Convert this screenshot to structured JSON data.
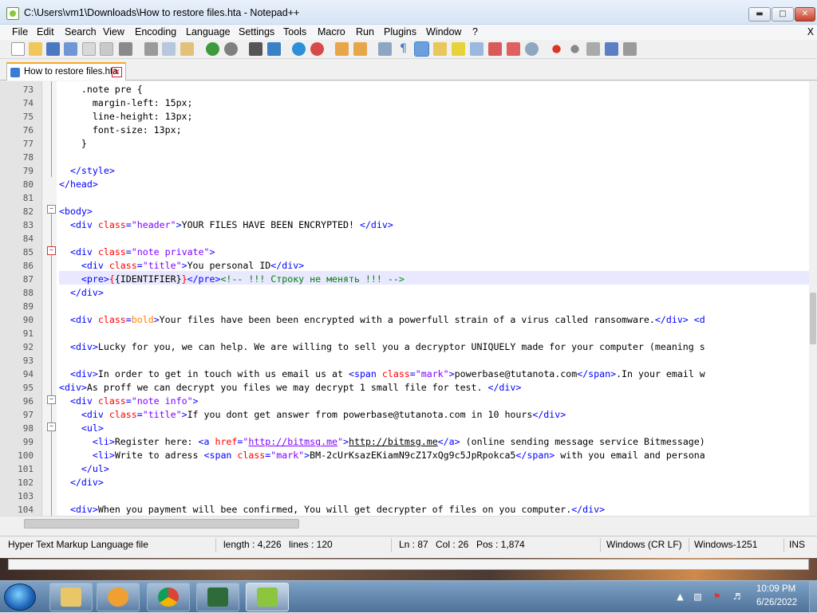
{
  "window": {
    "title": "C:\\Users\\vm1\\Downloads\\How to restore files.hta - Notepad++"
  },
  "menu": [
    "File",
    "Edit",
    "Search",
    "View",
    "Encoding",
    "Language",
    "Settings",
    "Tools",
    "Macro",
    "Run",
    "Plugins",
    "Window",
    "?"
  ],
  "menu_close": "X",
  "tab": {
    "label": "How to restore files.hta"
  },
  "lines": [
    {
      "n": "73",
      "html": "    .note pre {"
    },
    {
      "n": "74",
      "html": "      margin-left: 15px;"
    },
    {
      "n": "75",
      "html": "      line-height: 13px;"
    },
    {
      "n": "76",
      "html": "      font-size: 13px;"
    },
    {
      "n": "77",
      "html": "    }"
    },
    {
      "n": "78",
      "html": ""
    },
    {
      "n": "79",
      "html": "  <span class='t'>&lt;/style&gt;</span>"
    },
    {
      "n": "80",
      "html": "<span class='t'>&lt;/head&gt;</span>"
    },
    {
      "n": "81",
      "html": ""
    },
    {
      "n": "82",
      "html": "<span class='t'>&lt;body&gt;</span>"
    },
    {
      "n": "83",
      "html": "  <span class='t'>&lt;div</span> <span class='a'>class</span><span class='t'>=</span><span class='s'>\"header\"</span><span class='t'>&gt;</span>YOUR FILES HAVE BEEN ENCRYPTED! <span class='t'>&lt;/div&gt;</span>"
    },
    {
      "n": "84",
      "html": ""
    },
    {
      "n": "85",
      "html": "  <span class='t'>&lt;div</span> <span class='a'>class</span><span class='t'>=</span><span class='s'>\"note private\"</span><span class='t'>&gt;</span>"
    },
    {
      "n": "86",
      "html": "    <span class='t'>&lt;div</span> <span class='a'>class</span><span class='t'>=</span><span class='s'>\"title\"</span><span class='t'>&gt;</span>You personal ID<span class='t'>&lt;/div&gt;</span>"
    },
    {
      "n": "87",
      "html": "    <span class='t'>&lt;pre&gt;</span><span class='a'>{</span>{IDENTIFIER}<span class='a'>}</span><span class='t'>&lt;/pre&gt;</span><span class='c'>&lt;!-- !!! Строку не менять !!! --&gt;</span>"
    },
    {
      "n": "88",
      "html": "  <span class='t'>&lt;/div&gt;</span>"
    },
    {
      "n": "89",
      "html": ""
    },
    {
      "n": "90",
      "html": "  <span class='t'>&lt;div</span> <span class='a'>class</span><span class='t'>=</span><span style='color:#ff8000'>bold</span><span class='t'>&gt;</span>Your files have been been encrypted with a powerfull strain of a virus called ransomware.<span class='t'>&lt;/div&gt;</span> <span class='t'>&lt;d</span>"
    },
    {
      "n": "91",
      "html": ""
    },
    {
      "n": "92",
      "html": "  <span class='t'>&lt;div&gt;</span>Lucky for you, we can help. We are willing to sell you a decryptor UNIQUELY made for your computer (meaning s"
    },
    {
      "n": "93",
      "html": ""
    },
    {
      "n": "94",
      "html": "  <span class='t'>&lt;div&gt;</span>In order to get in touch with us email us at <span class='t'>&lt;span</span> <span class='a'>class</span><span class='t'>=</span><span class='s'>\"mark\"</span><span class='t'>&gt;</span>powerbase@tutanota.com<span class='t'>&lt;/span&gt;</span>.In your email w"
    },
    {
      "n": "95",
      "html": "<span class='t'>&lt;div&gt;</span>As proff we can decrypt you files we may decrypt 1 small file for test. <span class='t'>&lt;/div&gt;</span>"
    },
    {
      "n": "96",
      "html": "  <span class='t'>&lt;div</span> <span class='a'>class</span><span class='t'>=</span><span class='s'>\"note info\"</span><span class='t'>&gt;</span>"
    },
    {
      "n": "97",
      "html": "    <span class='t'>&lt;div</span> <span class='a'>class</span><span class='t'>=</span><span class='s'>\"title\"</span><span class='t'>&gt;</span>If you dont get answer from powerbase@tutanota.com in 10 hours<span class='t'>&lt;/div&gt;</span>"
    },
    {
      "n": "98",
      "html": "    <span class='t'>&lt;ul&gt;</span>"
    },
    {
      "n": "99",
      "html": "      <span class='t'>&lt;li&gt;</span>Register here: <span class='t'>&lt;a</span> <span class='a'>href</span><span class='t'>=</span><span class='s'>\"<u>http://bitmsg.me</u>\"</span><span class='t'>&gt;</span><u>http://bitmsg.me</u><span class='t'>&lt;/a&gt;</span> (online sending message service Bitmessage)"
    },
    {
      "n": "100",
      "html": "      <span class='t'>&lt;li&gt;</span>Write to adress <span class='t'>&lt;span</span> <span class='a'>class</span><span class='t'>=</span><span class='s'>\"mark\"</span><span class='t'>&gt;</span>BM-2cUrKsazEKiamN9cZ17xQg9c5JpRpokca5<span class='t'>&lt;/span&gt;</span> with you email and persona"
    },
    {
      "n": "101",
      "html": "    <span class='t'>&lt;/ul&gt;</span>"
    },
    {
      "n": "102",
      "html": "  <span class='t'>&lt;/div&gt;</span>"
    },
    {
      "n": "103",
      "html": ""
    },
    {
      "n": "104",
      "html": "  <span class='t'>&lt;div&gt;</span>When you payment will bee confirmed, You will get decrypter of files on you computer.<span class='t'>&lt;/div&gt;</span>"
    }
  ],
  "status": {
    "file_type": "Hyper Text Markup Language file",
    "length": "length : 4,226",
    "lines": "lines : 120",
    "ln": "Ln : 87",
    "col": "Col : 26",
    "pos": "Pos : 1,874",
    "eol": "Windows (CR LF)",
    "encoding": "Windows-1251",
    "mode": "INS"
  },
  "taskbar": {
    "time": "10:09 PM",
    "date": "6/26/2022"
  }
}
